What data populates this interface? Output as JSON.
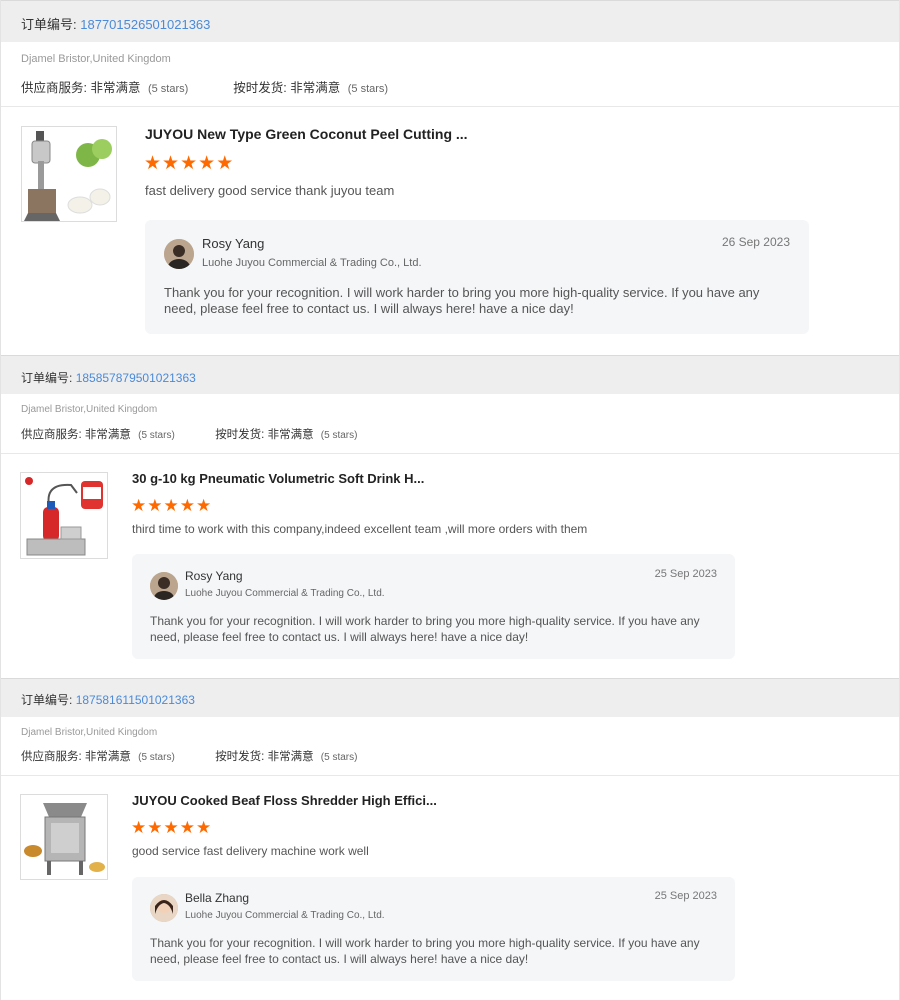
{
  "labels": {
    "order_no_label": "订单编号:",
    "supplier_service_label": "供应商服务:",
    "ontime_label": "按时发货:"
  },
  "reviews": [
    {
      "order_no": "187701526501021363",
      "buyer": "Djamel Bristor,United Kingdom",
      "supplier_service_value": "非常满意",
      "supplier_service_stars": "(5 stars)",
      "ontime_value": "非常满意",
      "ontime_stars": "(5 stars)",
      "product_title": "JUYOU New Type Green Coconut Peel Cutting ...",
      "rating": 5,
      "review_text": "fast delivery good service thank juyou team",
      "reply": {
        "name": "Rosy Yang",
        "company": "Luohe Juyou Commercial & Trading Co., Ltd.",
        "date": "26 Sep 2023",
        "text": "Thank you for your recognition. I will work harder to bring you more high-quality service. If you have any need, please feel free to contact us. I will always here! have a nice day!"
      }
    },
    {
      "order_no": "185857879501021363",
      "buyer": "Djamel Bristor,United Kingdom",
      "supplier_service_value": "非常满意",
      "supplier_service_stars": "(5 stars)",
      "ontime_value": "非常满意",
      "ontime_stars": "(5 stars)",
      "product_title": "30 g-10 kg Pneumatic Volumetric Soft Drink H...",
      "rating": 5,
      "review_text": "third time to work with this company,indeed excellent team ,will more orders with them",
      "reply": {
        "name": "Rosy Yang",
        "company": "Luohe Juyou Commercial & Trading Co., Ltd.",
        "date": "25 Sep 2023",
        "text": "Thank you for your recognition. I will work harder to bring you more high-quality service. If you have any need, please feel free to contact us. I will always here! have a nice day!"
      }
    },
    {
      "order_no": "187581611501021363",
      "buyer": "Djamel Bristor,United Kingdom",
      "supplier_service_value": "非常满意",
      "supplier_service_stars": "(5 stars)",
      "ontime_value": "非常满意",
      "ontime_stars": "(5 stars)",
      "product_title": "JUYOU Cooked Beaf Floss Shredder High Effici...",
      "rating": 5,
      "review_text": "good service fast delivery machine work well",
      "reply": {
        "name": "Bella Zhang",
        "company": "Luohe Juyou Commercial & Trading Co., Ltd.",
        "date": "25 Sep 2023",
        "text": "Thank you for your recognition. I will work harder to bring you more high-quality service. If you have any need, please feel free to contact us. I will always here! have a nice day!"
      }
    }
  ],
  "colors": {
    "star": "#ff6a00",
    "order_link": "#4a8ad8",
    "header_bg": "#eeeeee",
    "reply_bg": "#f4f6f8"
  },
  "icons": [
    "star-icon",
    "coconut-machine-product-image",
    "filling-machine-product-image",
    "shredder-machine-product-image",
    "reply-avatar"
  ]
}
